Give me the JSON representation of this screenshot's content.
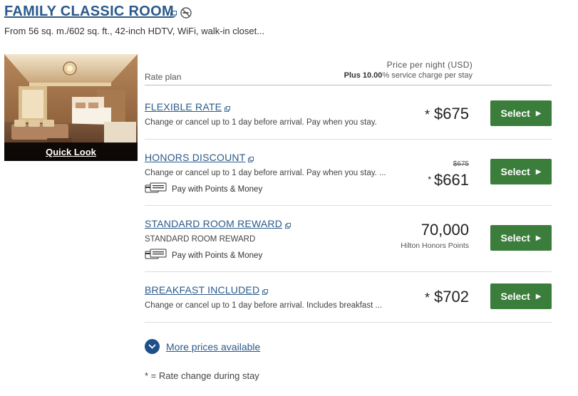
{
  "room": {
    "title": "FAMILY CLASSIC ROOM",
    "description": "From 56 sq. m./602 sq. ft., 42-inch HDTV, WiFi, walk-in closet...",
    "quick_look": "Quick Look"
  },
  "header": {
    "rate_plan": "Rate plan",
    "price_per_night": "Price per night (USD)",
    "service_prefix": "Plus 10.00",
    "service_suffix": "% service charge per stay"
  },
  "rates": [
    {
      "name": "FLEXIBLE RATE",
      "description": "Change or cancel up to 1 day before arrival. Pay when you stay.",
      "star": "*",
      "price": "$675",
      "button": "Select"
    },
    {
      "name": "HONORS DISCOUNT",
      "description": "Change or cancel up to 1 day before arrival. Pay when you stay. ...",
      "points_money": "Pay with Points & Money",
      "original_price": "$675",
      "star": "*",
      "price": "$661",
      "button": "Select"
    },
    {
      "name": "STANDARD ROOM REWARD",
      "description": "STANDARD ROOM REWARD",
      "points_money": "Pay with Points & Money",
      "points": "70,000",
      "points_label": "Hilton Honors Points",
      "button": "Select"
    },
    {
      "name": "BREAKFAST INCLUDED",
      "description": "Change or cancel up to 1 day before arrival. Includes breakfast ...",
      "star": "*",
      "price": "$702",
      "button": "Select"
    }
  ],
  "more_prices": "More prices available",
  "footnote": "* = Rate change during stay",
  "colors": {
    "link": "#2b5a8a",
    "select_button": "#3b7d3b",
    "more_circle": "#1f4f8a"
  }
}
